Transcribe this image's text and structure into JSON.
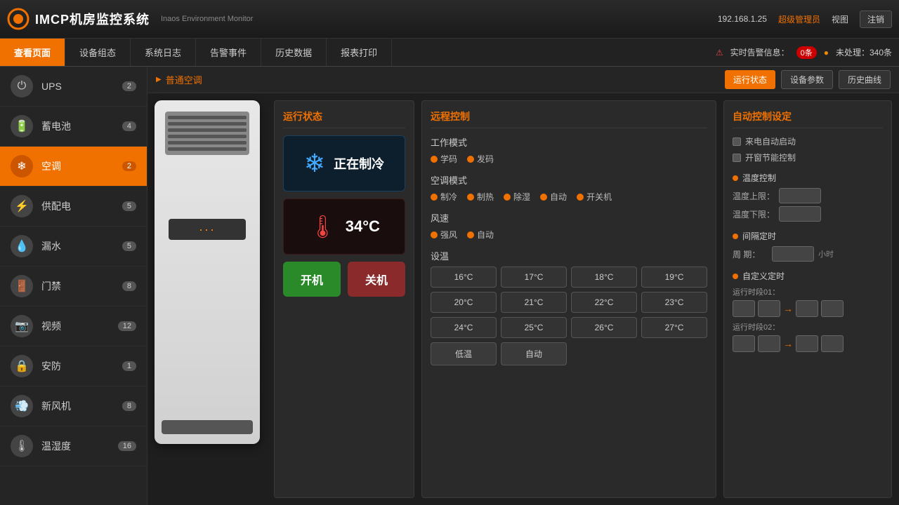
{
  "app": {
    "title": "IMCP机房监控系统",
    "subtitle": "Inaos Environment Monitor",
    "logo": "○",
    "ip": "192.168.1.25",
    "user": "超级管理员",
    "version": "视图"
  },
  "navbar": {
    "items": [
      {
        "label": "查看页面",
        "active": true
      },
      {
        "label": "设备组态",
        "active": false
      },
      {
        "label": "系统日志",
        "active": false
      },
      {
        "label": "告警事件",
        "active": false
      },
      {
        "label": "历史数据",
        "active": false
      },
      {
        "label": "报表打印",
        "active": false
      }
    ],
    "alerts": {
      "label": "实时告警信息：",
      "count": "0条",
      "unhandled": "未处理：340条"
    }
  },
  "sidebar": {
    "items": [
      {
        "label": "UPS",
        "count": "2",
        "icon": "⏻",
        "active": false
      },
      {
        "label": "蓄电池",
        "count": "4",
        "icon": "🔋",
        "active": false
      },
      {
        "label": "空调",
        "count": "2",
        "icon": "❄",
        "active": true
      },
      {
        "label": "供配电",
        "count": "5",
        "icon": "⚡",
        "active": false
      },
      {
        "label": "漏水",
        "count": "5",
        "icon": "💧",
        "active": false
      },
      {
        "label": "门禁",
        "count": "8",
        "icon": "🚪",
        "active": false
      },
      {
        "label": "视频",
        "count": "12",
        "icon": "📹",
        "active": false
      },
      {
        "label": "安防",
        "count": "1",
        "icon": "🔒",
        "active": false
      },
      {
        "label": "新风机",
        "count": "8",
        "icon": "💨",
        "active": false
      },
      {
        "label": "温湿度",
        "count": "16",
        "icon": "🌡",
        "active": false
      }
    ]
  },
  "breadcrumb": "普通空调",
  "toolbar": {
    "run_status": "运行状态",
    "device_params": "设备参数",
    "history_curve": "历史曲线"
  },
  "status_panel": {
    "title": "运行状态",
    "cooling_text": "正在制冷",
    "temperature": "34°C",
    "btn_on": "开机",
    "btn_off": "关机"
  },
  "remote_panel": {
    "title": "远程控制",
    "work_mode": {
      "title": "工作模式",
      "options": [
        "学码",
        "发码"
      ]
    },
    "ac_mode": {
      "title": "空调模式",
      "options": [
        "制冷",
        "制热",
        "除湿",
        "自动",
        "开关机"
      ]
    },
    "wind": {
      "title": "风速",
      "options": [
        "强风",
        "自动"
      ]
    },
    "temp_section": {
      "title": "设温",
      "buttons": [
        "16°C",
        "17°C",
        "18°C",
        "19°C",
        "20°C",
        "21°C",
        "22°C",
        "23°C",
        "24°C",
        "25°C",
        "26°C",
        "27°C",
        "低温",
        "自动"
      ]
    }
  },
  "auto_panel": {
    "title": "自动控制设定",
    "checkboxes": [
      "来电自动启动",
      "开窗节能控制"
    ],
    "temp_control": {
      "title": "温度控制",
      "upper": "温度上限：",
      "lower": "温度下限："
    },
    "timer": {
      "title": "间隔定时",
      "period_label": "周  期：",
      "unit": "小时"
    },
    "self_timer": {
      "title": "自定义定时",
      "period01": "运行时段01：",
      "period02": "运行时段02："
    }
  }
}
